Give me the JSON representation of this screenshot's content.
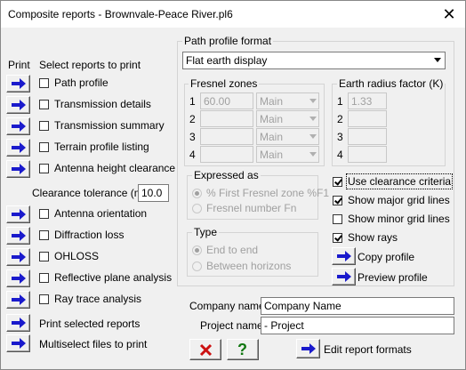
{
  "window": {
    "title": "Composite reports - Brownvale-Peace River.pl6"
  },
  "left": {
    "print_header": "Print",
    "select_header": "Select reports to print",
    "reports_top": [
      {
        "label": "Path profile",
        "checked": false
      },
      {
        "label": "Transmission details",
        "checked": false
      },
      {
        "label": "Transmission summary",
        "checked": false
      },
      {
        "label": "Terrain profile listing",
        "checked": false
      },
      {
        "label": "Antenna height clearance",
        "checked": false
      }
    ],
    "clearance_label": "Clearance tolerance (m)",
    "clearance_value": "10.0",
    "reports_bottom": [
      {
        "label": "Antenna orientation",
        "checked": false
      },
      {
        "label": "Diffraction loss",
        "checked": false
      },
      {
        "label": "OHLOSS",
        "checked": false
      },
      {
        "label": "Reflective plane analysis",
        "checked": false
      },
      {
        "label": "Ray trace analysis",
        "checked": false
      }
    ],
    "print_selected": "Print selected reports",
    "multiselect": "Multiselect files to print"
  },
  "profile": {
    "group_label": "Path profile format",
    "format_value": "Flat earth display",
    "fresnel": {
      "label": "Fresnel zones",
      "rows": [
        {
          "num": "1",
          "value": "60.00",
          "main": "Main"
        },
        {
          "num": "2",
          "value": "",
          "main": "Main"
        },
        {
          "num": "3",
          "value": "",
          "main": "Main"
        },
        {
          "num": "4",
          "value": "",
          "main": "Main"
        }
      ]
    },
    "earth": {
      "label": "Earth radius factor (K)",
      "rows": [
        {
          "num": "1",
          "value": "1.33"
        },
        {
          "num": "2",
          "value": ""
        },
        {
          "num": "3",
          "value": ""
        },
        {
          "num": "4",
          "value": ""
        }
      ]
    },
    "expressed": {
      "label": "Expressed as",
      "opt1": "% First Fresnel zone %F1",
      "opt2": "Fresnel number Fn"
    },
    "type": {
      "label": "Type",
      "opt1": "End to end",
      "opt2": "Between horizons"
    },
    "options": [
      {
        "label": "Use clearance criteria",
        "checked": true
      },
      {
        "label": "Show major grid lines",
        "checked": true
      },
      {
        "label": "Show minor grid lines",
        "checked": false
      },
      {
        "label": "Show rays",
        "checked": true
      }
    ],
    "copy_profile": "Copy profile",
    "preview_profile": "Preview profile"
  },
  "footer": {
    "company_label": "Company name",
    "company_value": "Company Name",
    "project_label": "Project name",
    "project_value": "- Project",
    "help_glyph": "?",
    "edit_formats": "Edit report formats"
  },
  "colors": {
    "arrow_blue": "#1a1acc",
    "cancel_red": "#cc1111",
    "help_green": "#117711"
  }
}
